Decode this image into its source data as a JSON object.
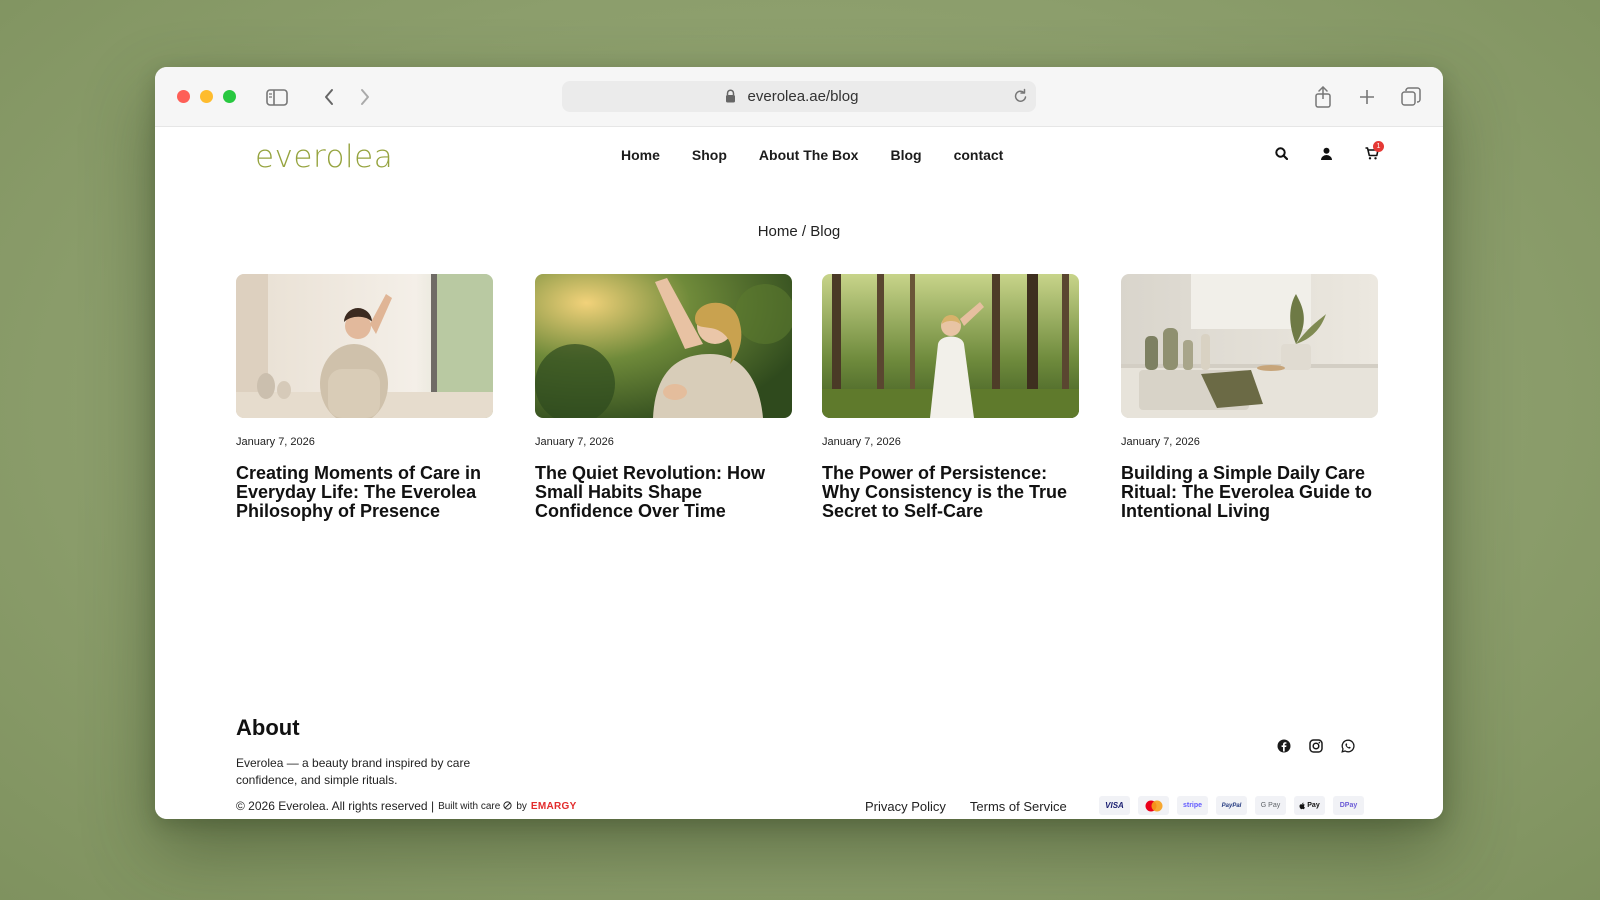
{
  "browser": {
    "url": "everolea.ae/blog"
  },
  "header": {
    "logo": "everolea",
    "nav": [
      "Home",
      "Shop",
      "About The Box",
      "Blog",
      "contact"
    ],
    "cart_count": "1"
  },
  "breadcrumb": "Home / Blog",
  "posts": [
    {
      "date": "January 7, 2026",
      "title": "Creating Moments of Care in Everyday Life: The Everolea Philosophy of Presence"
    },
    {
      "date": "January 7, 2026",
      "title": "The Quiet Revolution: How Small Habits Shape Confidence Over Time"
    },
    {
      "date": "January 7, 2026",
      "title": "The Power of Persistence: Why Consistency is the True Secret to Self-Care"
    },
    {
      "date": "January 7, 2026",
      "title": "Building a Simple Daily Care Ritual: The Everolea Guide to Intentional Living"
    }
  ],
  "footer": {
    "about_heading": "About",
    "about_text": "Everolea — a beauty brand inspired by care confidence, and simple rituals.",
    "copyright": "© 2026 Everolea. All rights reserved |",
    "built_with": "Built with care",
    "by": "by",
    "builder": "EMARGY",
    "links": [
      "Privacy Policy",
      "Terms of Service"
    ],
    "payments": [
      "VISA",
      "",
      "stripe",
      "PayPal",
      "G Pay",
      "Pay",
      "DPay"
    ]
  },
  "colors": {
    "logo": "#95a33e",
    "badge": "#e53935",
    "builder": "#e22b2b"
  }
}
